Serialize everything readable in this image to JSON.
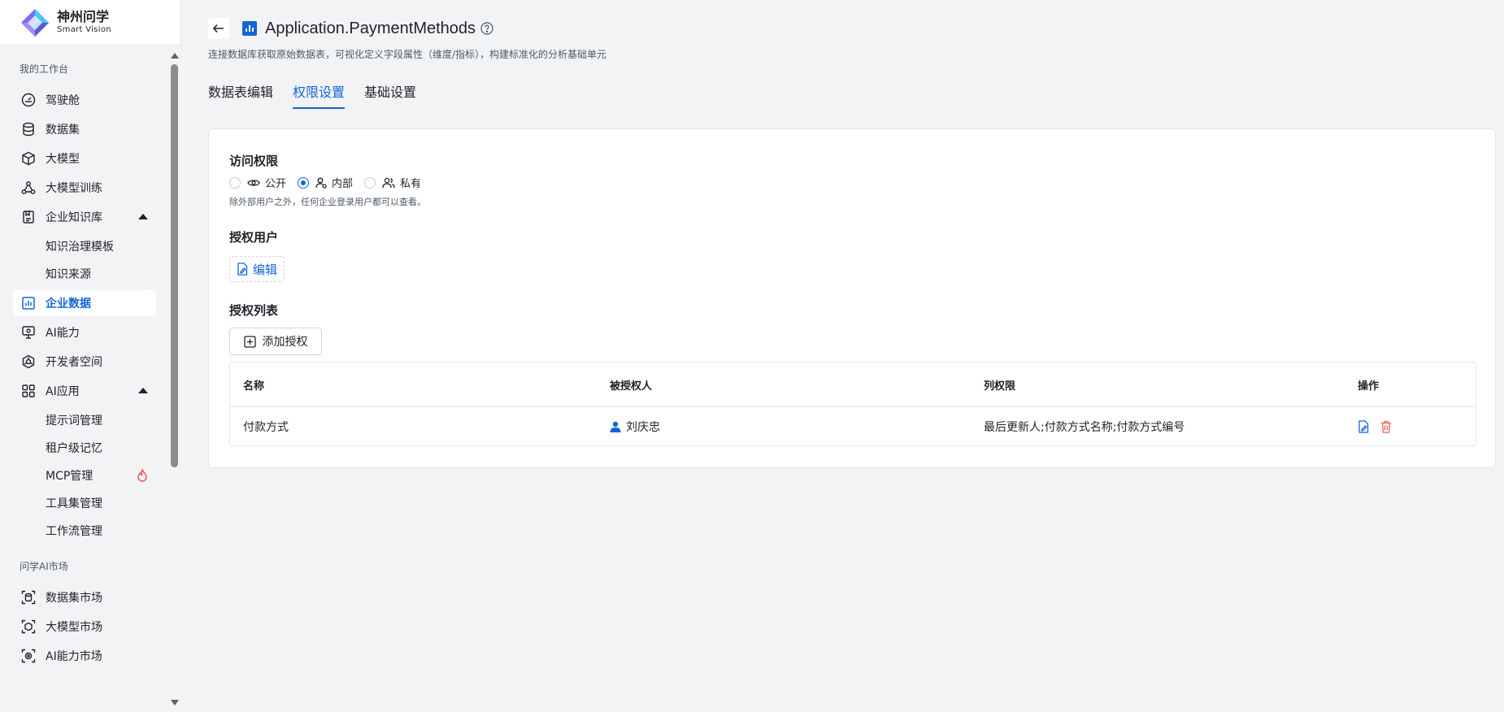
{
  "brand": {
    "title": "神州问学",
    "subtitle": "Smart Vision"
  },
  "sidebar": {
    "groups": [
      {
        "label": "我的工作台"
      },
      {
        "label": "问学AI市场"
      }
    ],
    "items": [
      {
        "label": "驾驶舱",
        "icon": "dashboard-icon"
      },
      {
        "label": "数据集",
        "icon": "database-icon"
      },
      {
        "label": "大模型",
        "icon": "cube-icon"
      },
      {
        "label": "大模型训练",
        "icon": "training-icon"
      },
      {
        "label": "企业知识库",
        "icon": "knowledge-icon"
      },
      {
        "label": "企业数据",
        "icon": "chart-icon"
      },
      {
        "label": "AI能力",
        "icon": "ai-monitor-icon"
      },
      {
        "label": "开发者空间",
        "icon": "dev-space-icon"
      },
      {
        "label": "AI应用",
        "icon": "apps-grid-icon"
      },
      {
        "label": "数据集市场",
        "icon": "dataset-market-icon"
      },
      {
        "label": "大模型市场",
        "icon": "model-market-icon"
      },
      {
        "label": "AI能力市场",
        "icon": "ai-market-icon"
      }
    ],
    "knowledge_sub": [
      "知识治理模板",
      "知识来源"
    ],
    "app_sub": [
      "提示词管理",
      "租户级记忆",
      "MCP管理",
      "工具集管理",
      "工作流管理"
    ]
  },
  "header": {
    "title": "Application.PaymentMethods",
    "subtitle": "连接数据库获取原始数据表，可视化定义字段属性（维度/指标），构建标准化的分析基础单元"
  },
  "tabs": [
    "数据表编辑",
    "权限设置",
    "基础设置"
  ],
  "active_tab": "权限设置",
  "access": {
    "title": "访问权限",
    "options": [
      "公开",
      "内部",
      "私有"
    ],
    "selected": "内部",
    "hint": "除外部用户之外，任何企业登录用户都可以查看。"
  },
  "auth_users": {
    "title": "授权用户",
    "edit_label": "编辑"
  },
  "auth_list": {
    "title": "授权列表",
    "add_label": "添加授权",
    "columns": [
      "名称",
      "被授权人",
      "列权限",
      "操作"
    ],
    "rows": [
      {
        "name": "付款方式",
        "grantee": "刘庆忠",
        "columns": "最后更新人;付款方式名称;付款方式编号"
      }
    ]
  },
  "colors": {
    "accent": "#1565d8",
    "danger": "#f25c54",
    "fire": "#f5484a"
  }
}
